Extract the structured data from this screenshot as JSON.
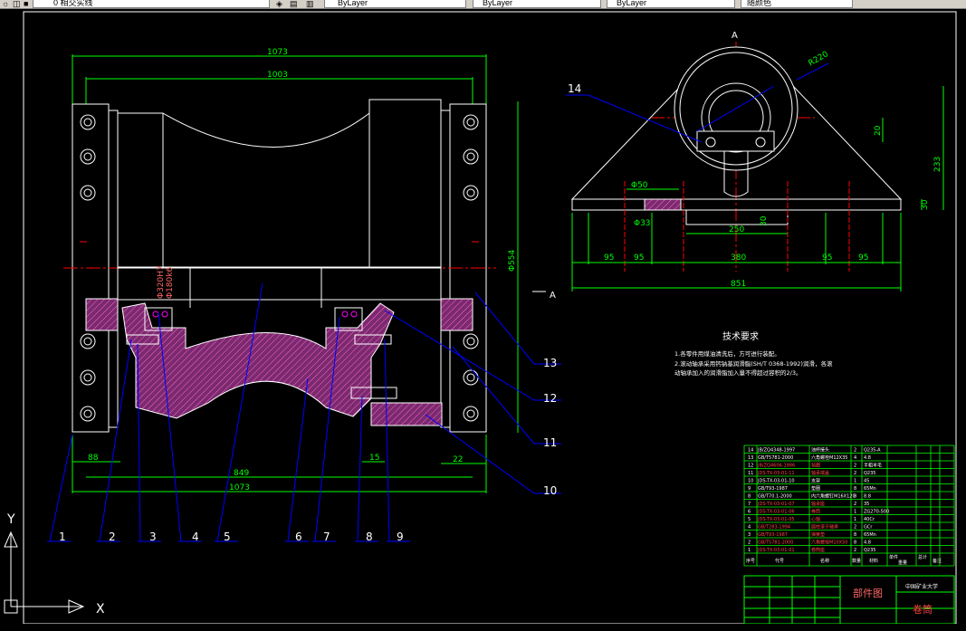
{
  "toolbar": {
    "layer_combo_text": "0 相交实线",
    "color_combo_text": "ByLayer",
    "linetype_combo_text": "ByLayer",
    "lineweight_combo_text": "ByLayer",
    "plotstyle_combo_text": "随颜色"
  },
  "colors": {
    "background": "#000000",
    "border": "#ffffff",
    "dimension": "#00ff00",
    "leader": "#0000ff",
    "section": "#800080",
    "hatch": "#ff00ff",
    "centerline": "#ff0000",
    "table": "#00ff00",
    "text": "#ffffff"
  },
  "front_view": {
    "dims": {
      "top_overall": "1073",
      "top_inner": "1003",
      "bottom_left": "88",
      "bottom_mid": "849",
      "bottom_overall": "1073",
      "right_small": "22",
      "bottom_15": "15",
      "right_vertical": "Φ554",
      "shaft_d1": "Φ320H7",
      "shaft_d2": "Φ180k6"
    },
    "section_marker": "A",
    "balloons": [
      "1",
      "2",
      "3",
      "4",
      "5",
      "6",
      "7",
      "8",
      "9",
      "10",
      "11",
      "12",
      "13"
    ]
  },
  "side_view": {
    "view_label": "A",
    "balloon_14": "14",
    "dims": {
      "radius": "R220",
      "d_bolt": "Φ50",
      "d_hole": "Φ33",
      "width_250": "250",
      "h_20": "20",
      "h_233": "233",
      "h_30": "30",
      "h_30b": "30",
      "seg_95_1": "95",
      "seg_95_2": "95",
      "seg_380": "380",
      "seg_95_3": "95",
      "seg_95_4": "95",
      "overall_851": "851"
    }
  },
  "tech_requirements": {
    "title": "技术要求",
    "line1": "1.各零件用煤油清洗后，方可进行装配。",
    "line2": "2.滚动轴承采用钙钠基润滑脂(SH/T 0368-1992)润滑，各滚",
    "line3": "动轴承加入的润滑脂加入量不得超过容积的2/3。"
  },
  "bom": {
    "rows": [
      {
        "no": "14",
        "code": "JB/ZQ4348-1997",
        "name": "油杯接头",
        "qty": "2",
        "mat": "Q235-A"
      },
      {
        "no": "13",
        "code": "GB/T5781-2000",
        "name": "六角螺栓M12X35",
        "qty": "4",
        "mat": "4.8"
      },
      {
        "no": "12",
        "code": "JB/ZQ4606-1986",
        "name": "毡圈",
        "qty": "2",
        "mat": "半粗羊毛"
      },
      {
        "no": "11",
        "code": "JDS-TX-03-01-11",
        "name": "轴承端盖",
        "qty": "2",
        "mat": "Q235"
      },
      {
        "no": "10",
        "code": "JDS-TX-03-01-10",
        "name": "支架",
        "qty": "1",
        "mat": "45"
      },
      {
        "no": "9",
        "code": "GB/T93-1987",
        "name": "垫圈",
        "qty": "8",
        "mat": "65Mn"
      },
      {
        "no": "8",
        "code": "GB/T70.1-2000",
        "name": "内六角螺钉M16X120",
        "qty": "8",
        "mat": "8.8"
      },
      {
        "no": "7",
        "code": "JDS-TX-03-01-07",
        "name": "轴承座",
        "qty": "2",
        "mat": "35"
      },
      {
        "no": "6",
        "code": "JDS-TX-03-01-06",
        "name": "卷筒",
        "qty": "1",
        "mat": "ZG270-500"
      },
      {
        "no": "5",
        "code": "JDS-TX-03-01-05",
        "name": "心轴",
        "qty": "1",
        "mat": "40Cr"
      },
      {
        "no": "4",
        "code": "GB/T283-1994",
        "name": "圆柱滚子轴承",
        "qty": "2",
        "mat": "GCr"
      },
      {
        "no": "3",
        "code": "GB/T93-1987",
        "name": "弹簧垫",
        "qty": "8",
        "mat": "65Mn"
      },
      {
        "no": "2",
        "code": "GB/T5781-2000",
        "name": "六角螺栓M10X50",
        "qty": "8",
        "mat": "4.8"
      },
      {
        "no": "1",
        "code": "JDS-TX-03-01-01",
        "name": "卷筒座",
        "qty": "2",
        "mat": "Q235"
      }
    ],
    "header": {
      "no": "序号",
      "code": "代号",
      "name": "名称",
      "qty": "数量",
      "mat": "材料",
      "unit_weight": "单件",
      "total_weight": "总计",
      "weight_label": "重量",
      "remark": "备注"
    },
    "title_block": {
      "drawing_type": "部件图",
      "part_name": "卷筒",
      "school": "中国矿业大学"
    }
  },
  "ucs": {
    "x_label": "X",
    "y_label": "Y"
  }
}
